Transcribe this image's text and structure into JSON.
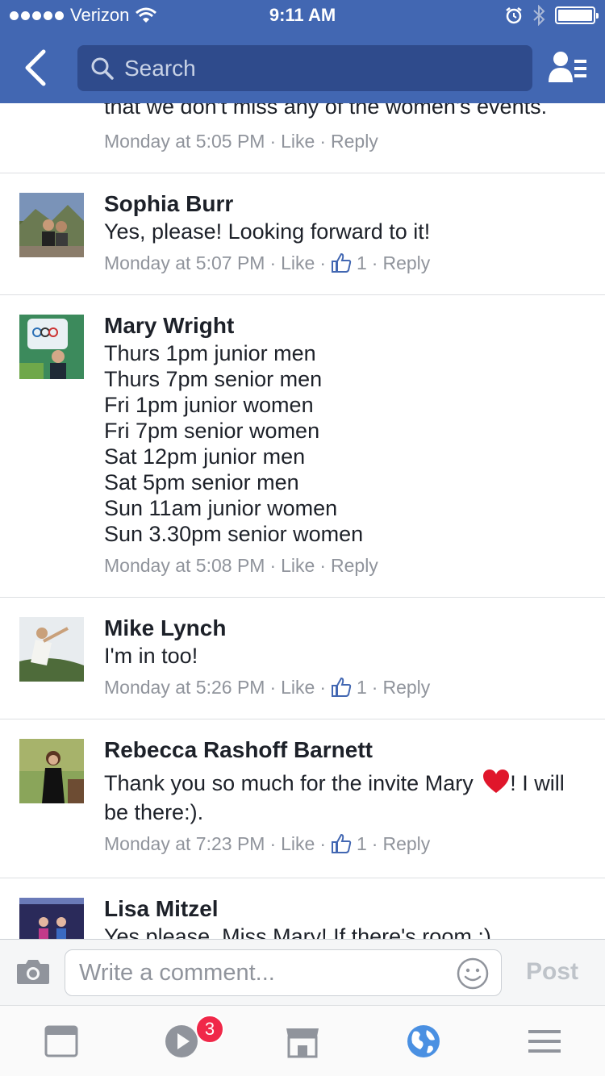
{
  "status_bar": {
    "carrier": "Verizon",
    "time": "9:11 AM"
  },
  "header": {
    "search_placeholder": "Search"
  },
  "comments": [
    {
      "author": "",
      "text": "that we don't miss any of the women's events.",
      "time": "Monday at 5:05 PM",
      "like_label": "Like",
      "reply_label": "Reply",
      "likes": ""
    },
    {
      "author": "Sophia Burr",
      "text": "Yes, please! Looking forward to it!",
      "time": "Monday at 5:07 PM",
      "like_label": "Like",
      "reply_label": "Reply",
      "likes": "1"
    },
    {
      "author": "Mary Wright",
      "lines": [
        "Thurs 1pm junior men",
        "Thurs 7pm senior men",
        "Fri 1pm junior women",
        "Fri 7pm senior women",
        "Sat 12pm junior men",
        "Sat 5pm senior men",
        "Sun 11am junior women",
        "Sun 3.30pm senior women"
      ],
      "time": "Monday at 5:08 PM",
      "like_label": "Like",
      "reply_label": "Reply",
      "likes": ""
    },
    {
      "author": "Mike Lynch",
      "text": "I'm in too!",
      "time": "Monday at 5:26 PM",
      "like_label": "Like",
      "reply_label": "Reply",
      "likes": "1"
    },
    {
      "author": "Rebecca Rashoff Barnett",
      "text": "Thank you so much for the invite Mary",
      "text_after": "! I will be there:).",
      "time": "Monday at 7:23 PM",
      "like_label": "Like",
      "reply_label": "Reply",
      "likes": "1"
    },
    {
      "author": "Lisa Mitzel",
      "text": "Yes please, Miss Mary! If there's room :)"
    }
  ],
  "composer": {
    "placeholder": "Write a comment...",
    "post_label": "Post"
  },
  "tabbar": {
    "video_badge": "3"
  },
  "colors": {
    "brand": "#4267b2",
    "meta_gray": "#90949c",
    "badge": "#f02849"
  }
}
